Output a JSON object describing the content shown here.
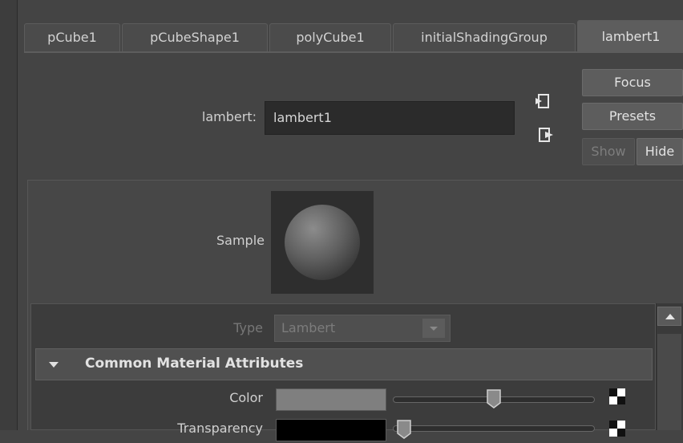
{
  "tabs": [
    {
      "label": "pCube1"
    },
    {
      "label": "pCubeShape1"
    },
    {
      "label": "polyCube1"
    },
    {
      "label": "initialShadingGroup"
    },
    {
      "label": "lambert1",
      "active": true
    }
  ],
  "node": {
    "name_label": "lambert:",
    "name_value": "lambert1"
  },
  "buttons": {
    "focus": "Focus",
    "presets": "Presets",
    "show": "Show",
    "hide": "Hide"
  },
  "sample": {
    "label": "Sample"
  },
  "type": {
    "label": "Type",
    "value": "Lambert"
  },
  "section": {
    "title": "Common Material Attributes",
    "expanded": true
  },
  "attributes": [
    {
      "label": "Color",
      "swatch": "#7f7f7f",
      "slider_fraction": 0.5
    },
    {
      "label": "Transparency",
      "swatch": "#000000",
      "slider_fraction": 0.0
    }
  ],
  "icons": {
    "input_connection": "arrow-in-icon",
    "output_connection": "arrow-out-icon",
    "map_button": "checker-icon",
    "dropdown": "chevron-down-icon",
    "scroll_up": "triangle-up-icon",
    "collapse": "triangle-down-icon"
  }
}
